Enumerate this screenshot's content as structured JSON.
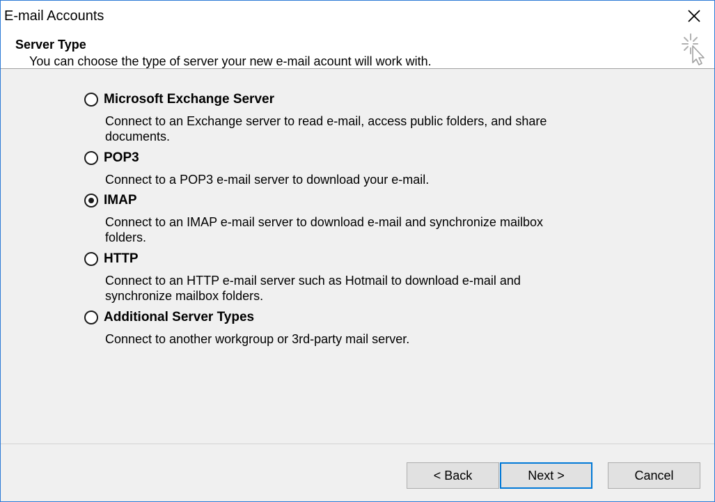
{
  "window": {
    "title": "E-mail Accounts"
  },
  "header": {
    "title": "Server Type",
    "subtitle": "You can choose the type of server your new e-mail acount will work with."
  },
  "options": [
    {
      "label": "Microsoft Exchange Server",
      "description": "Connect to an Exchange server to read e-mail, access public folders, and share documents.",
      "selected": false
    },
    {
      "label": "POP3",
      "description": "Connect to a POP3 e-mail server to download your e-mail.",
      "selected": false
    },
    {
      "label": "IMAP",
      "description": "Connect to an IMAP e-mail server to download e-mail and synchronize mailbox folders.",
      "selected": true
    },
    {
      "label": "HTTP",
      "description": "Connect to an HTTP e-mail server such as Hotmail to download e-mail and synchronize mailbox folders.",
      "selected": false
    },
    {
      "label": "Additional Server Types",
      "description": "Connect to another workgroup or 3rd-party mail server.",
      "selected": false
    }
  ],
  "buttons": {
    "back": "< Back",
    "next": "Next >",
    "cancel": "Cancel"
  },
  "icons": {
    "close": "close-icon",
    "wizard": "wizard-cursor-icon"
  },
  "colors": {
    "window_border": "#2b79d6",
    "default_button_border": "#0078d7",
    "panel_background": "#f0f0f0"
  }
}
